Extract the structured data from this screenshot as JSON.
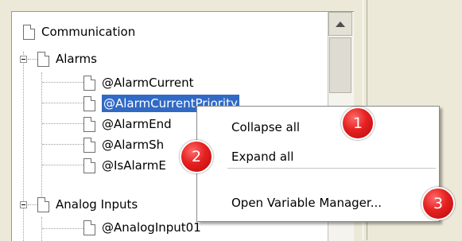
{
  "tree": {
    "items": [
      {
        "label": "Communication",
        "level": 0,
        "expander": "none",
        "selected": false
      },
      {
        "label": "Alarms",
        "level": 0,
        "expander": "minus",
        "selected": false
      },
      {
        "label": "@AlarmCurrent",
        "level": 1,
        "expander": "none",
        "selected": false
      },
      {
        "label": "@AlarmCurrentPriority",
        "level": 1,
        "expander": "none",
        "selected": true
      },
      {
        "label": "@AlarmEnd",
        "level": 1,
        "expander": "none",
        "selected": false
      },
      {
        "label": "@AlarmSh",
        "level": 1,
        "expander": "none",
        "selected": false
      },
      {
        "label": "@IsAlarmE",
        "level": 1,
        "expander": "none",
        "selected": false
      },
      {
        "label": "Analog Inputs",
        "level": 0,
        "expander": "minus",
        "selected": false
      },
      {
        "label": "@AnalogInput01",
        "level": 1,
        "expander": "none",
        "selected": false
      }
    ]
  },
  "context_menu": {
    "items": [
      {
        "label": "Collapse all"
      },
      {
        "label": "Expand all"
      },
      {
        "label": "Open Variable Manager..."
      }
    ]
  },
  "callouts": [
    {
      "number": "1"
    },
    {
      "number": "2"
    },
    {
      "number": "3"
    }
  ],
  "colors": {
    "selection": "#316ac5",
    "callout": "#e62020",
    "window_bg": "#ece9d8"
  }
}
